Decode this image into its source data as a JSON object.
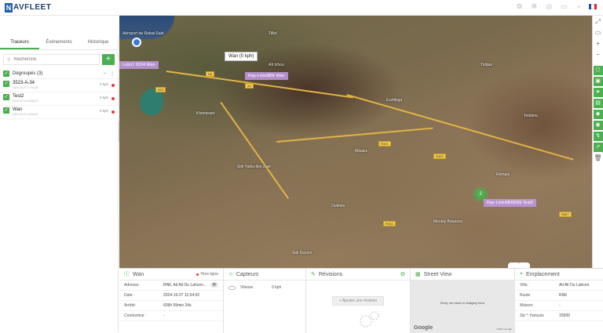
{
  "app": {
    "logo_letter": "N",
    "logo_text": "AVFLEET"
  },
  "topbar": {
    "icons": [
      "settings-icon",
      "gear-icon",
      "help-icon",
      "account-icon",
      "notification-icon"
    ],
    "flag_colors": [
      "#1f4fa0",
      "#ffffff",
      "#e0202a"
    ]
  },
  "sidebar": {
    "tabs": [
      "Traceurs",
      "Événements",
      "Historique"
    ],
    "search_placeholder": "Recherche",
    "add_label": "+",
    "group": {
      "label": "Dégroupés (3)"
    },
    "devices": [
      {
        "name": "3523-A-34",
        "time": "2024-10-27 17:01:24",
        "speed": "0 kph"
      },
      {
        "name": "Test2",
        "time": "2024-10-13 18:55:13",
        "speed": "0 kph"
      },
      {
        "name": "Wan",
        "time": "2024-10-27 11:54:02",
        "speed": "0 kph"
      }
    ]
  },
  "map": {
    "callout": "Wan (0 kph)",
    "labels": [
      "Ray-Lmtn8Bfr Wan",
      "Lmtn1 8104 Wan",
      "Ray-Lmtn8Bf0099 Test2"
    ],
    "cluster_count": "2",
    "places": [
      "Aéroport de Rabat-Salé",
      "Tiflet",
      "Khemisset",
      "Sidi Yahia des Zaer",
      "Mâaziz",
      "Ezzhiliga",
      "Oulmès",
      "Tedders",
      "Romani",
      "Moulay Bouazza",
      "Aït Ichou",
      "Tiddas",
      "Sidi Kacem"
    ],
    "roads": [
      "N6",
      "A2",
      "R401",
      "R403",
      "N13",
      "R404",
      "R407"
    ]
  },
  "right_toolbar": {
    "icons": [
      "fullscreen-icon",
      "layers-icon",
      "zoom-in-icon",
      "zoom-out-icon",
      "geofence-icon",
      "camera-icon",
      "navigate-icon",
      "ruler-icon",
      "poi-icon",
      "location-icon",
      "route-icon",
      "share-icon",
      "delete-icon"
    ]
  },
  "panels": {
    "wan": {
      "title": "Wan",
      "status": "Hors ligne",
      "rows": [
        {
          "key": "Adresse:",
          "value": "RN6, Ait Ali Ou Lahcen..."
        },
        {
          "key": "Date:",
          "value": "2024-10-27 11:54:02"
        },
        {
          "key": "Arrêté:",
          "value": "609h 59min 24s"
        },
        {
          "key": "Conducteur :",
          "value": "-"
        }
      ]
    },
    "capteurs": {
      "title": "Capteurs",
      "row_label": "Vitesse",
      "row_value": "0 kph"
    },
    "revisions": {
      "title": "Révisions",
      "add_label": "+ Ajouter une révision"
    },
    "street_view": {
      "title": "Street View",
      "message": "Sorry, we have no imagery here.",
      "google": "Google",
      "copyright": "©2017 Google"
    },
    "emplacement": {
      "title": "Emplacement",
      "rows": [
        {
          "key": "Ville:",
          "value": "Ait Ali Ou Lahcen"
        },
        {
          "key": "Route",
          "value": "RN6"
        },
        {
          "key": "Maison:",
          "value": "-"
        },
        {
          "key": "Zip *: français",
          "value": "15500"
        }
      ]
    }
  }
}
